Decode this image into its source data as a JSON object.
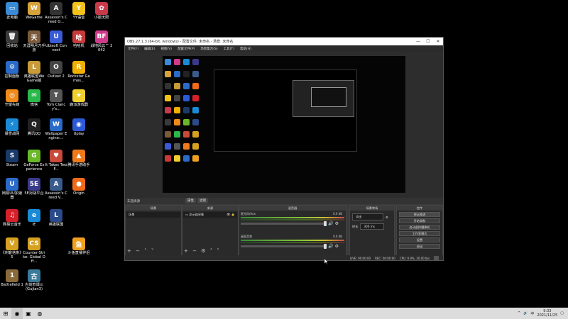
{
  "desktop": {
    "icons": [
      {
        "label": "此电脑",
        "glyph": "▭",
        "color": "#3a8ad6"
      },
      {
        "label": "WeGame",
        "glyph": "W",
        "color": "#d6a23a"
      },
      {
        "label": "Assassin's Creed O...",
        "glyph": "A",
        "color": "#333"
      },
      {
        "label": "YY语音",
        "glyph": "Y",
        "color": "#f2c21a"
      },
      {
        "label": "小姐无限",
        "glyph": "✿",
        "color": "#c83a4a"
      },
      {
        "label": "回收站",
        "glyph": "🗑",
        "color": "#3a3a3a"
      },
      {
        "label": "天涯明月刀手游",
        "glyph": "天",
        "color": "#7a5a3a"
      },
      {
        "label": "Ubisoft Connect",
        "glyph": "U",
        "color": "#3a5ad6"
      },
      {
        "label": "哈哈机",
        "glyph": "哈",
        "color": "#c83a3a"
      },
      {
        "label": "战地风云™ 2042",
        "glyph": "BF",
        "color": "#d03a8a"
      },
      {
        "label": "控制面板",
        "glyph": "⚙",
        "color": "#2a6ac8"
      },
      {
        "label": "英雄联盟WeGame版",
        "glyph": "L",
        "color": "#c89a3a"
      },
      {
        "label": "Outlast 2",
        "glyph": "O",
        "color": "#444"
      },
      {
        "label": "Rockstar Games...",
        "glyph": "R",
        "color": "#f0b000"
      },
      {
        "label": "守望先锋",
        "glyph": "◎",
        "color": "#f08a1a"
      },
      {
        "label": "微信",
        "glyph": "✉",
        "color": "#2ab84a"
      },
      {
        "label": "Tom Clancy's...",
        "glyph": "T",
        "color": "#555"
      },
      {
        "label": "鹿派游戏器",
        "glyph": "★",
        "color": "#f0d030"
      },
      {
        "label": "暴雪战网",
        "glyph": "⚡",
        "color": "#1a8ad6"
      },
      {
        "label": "腾讯QQ",
        "glyph": "Q",
        "color": "#222"
      },
      {
        "label": "Wallpaper Engine:...",
        "glyph": "W",
        "color": "#2a6ac8"
      },
      {
        "label": "Uplay",
        "glyph": "◉",
        "color": "#2a5ad6"
      },
      {
        "label": "Steam",
        "glyph": "S",
        "color": "#1a3a6a"
      },
      {
        "label": "GeForce Experience",
        "glyph": "G",
        "color": "#6ab82a"
      },
      {
        "label": "It Takes Two F...",
        "glyph": "♥",
        "color": "#c84a3a"
      },
      {
        "label": "腾讯手游助手",
        "glyph": "▲",
        "color": "#f07a1a"
      },
      {
        "label": "网易UU加速器",
        "glyph": "U",
        "color": "#2a6ac8"
      },
      {
        "label": "5E对战平台",
        "glyph": "5E",
        "color": "#3a3a8a"
      },
      {
        "label": "Assassin's Creed V...",
        "glyph": "A",
        "color": "#3a5a8a"
      },
      {
        "label": "Origin",
        "glyph": "●",
        "color": "#f06a1a"
      },
      {
        "label": "网易云音乐",
        "glyph": "♫",
        "color": "#d6202a"
      },
      {
        "label": "IE",
        "glyph": "e",
        "color": "#1a8ad6"
      },
      {
        "label": "英雄联盟",
        "glyph": "L",
        "color": "#2a4a8a"
      },
      {
        "label": "《刺客信条》 5",
        "glyph": "V",
        "color": "#d6a020"
      },
      {
        "label": "Counter-Strike: Global Off...",
        "glyph": "CS",
        "color": "#d6a020"
      },
      {
        "label": "斗鱼直播伴侣",
        "glyph": "鱼",
        "color": "#f0a020"
      },
      {
        "label": "Battlefield 1",
        "glyph": "1",
        "color": "#8a6a3a"
      },
      {
        "label": "古剑奇谭三 (Gujian3)",
        "glyph": "古",
        "color": "#3a7a9a"
      }
    ]
  },
  "obs": {
    "title": "OBS 27.1.3 (64-bit, windows) - 配置文件: 未命名 - 场景: 未命名",
    "window_controls": [
      "—",
      "☐",
      "✕"
    ],
    "menu": [
      "文件(F)",
      "编辑(E)",
      "视图(V)",
      "配置文件(P)",
      "场景集合(S)",
      "工具(T)",
      "帮助(H)"
    ],
    "docks_header": "未选择源",
    "scene_tabs": [
      "属性",
      "滤镜"
    ],
    "scenes": {
      "header": "场景",
      "items": [
        "场景"
      ],
      "toolbar": "+ − ˄ ˅"
    },
    "sources": {
      "header": "来源",
      "items": [
        "显示器采集"
      ],
      "toolbar": "+ − ⚙ ˄ ˅"
    },
    "mixer": {
      "header": "混音器",
      "channels": [
        {
          "name": "麦克风/Aux",
          "db": "0.0 dB"
        },
        {
          "name": "桌面音频",
          "db": "0.0 dB"
        }
      ]
    },
    "transitions": {
      "header": "场景转场",
      "type": "淡出",
      "duration_label": "时长",
      "duration": "300 ms"
    },
    "controls": {
      "header": "控件",
      "buttons": [
        "停止推流",
        "开始录制",
        "启动虚拟摄像机",
        "工作室模式",
        "设置",
        "退出"
      ]
    },
    "status": {
      "live": "LIVE: 00:00:00",
      "rec": "REC: 00:00:00",
      "cpu": "CPU: 0.9%, 30.00 fps"
    }
  },
  "taskbar": {
    "time": "9:33",
    "date": "2021/11/25",
    "tray_icons": [
      "^",
      "🔊",
      "中"
    ]
  }
}
